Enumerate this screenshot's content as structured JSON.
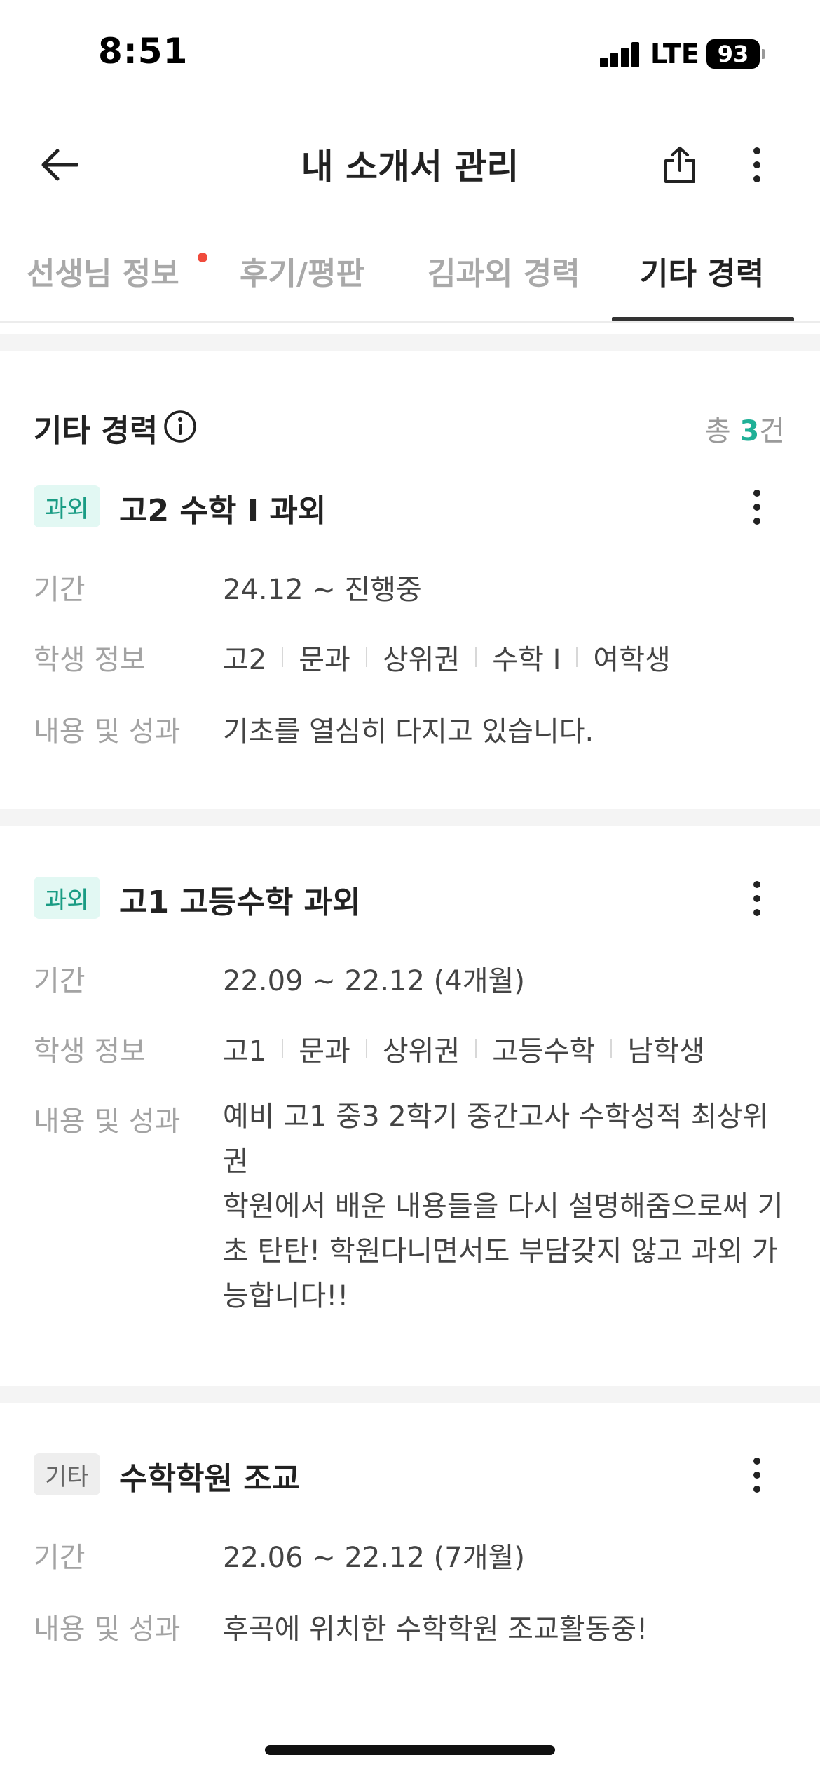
{
  "status_bar": {
    "time": "8:51",
    "network": "LTE",
    "battery": "93"
  },
  "header": {
    "title": "내 소개서 관리"
  },
  "tabs": [
    {
      "label": "선생님 정보",
      "has_dot": true
    },
    {
      "label": "후기/평판"
    },
    {
      "label": "김과외 경력"
    },
    {
      "label": "기타 경력",
      "active": true
    }
  ],
  "section": {
    "title": "기타 경력",
    "count_prefix": "총 ",
    "count": "3",
    "count_suffix": "건"
  },
  "labels": {
    "period": "기간",
    "student_info": "학생 정보",
    "content": "내용 및 성과"
  },
  "cards": [
    {
      "badge": "과외",
      "title": "고2 수학 I 과외",
      "period": "24.12 ~ 진행중",
      "student_tags": [
        "고2",
        "문과",
        "상위권",
        "수학 I",
        "여학생"
      ],
      "content": "기초를 열심히 다지고 있습니다."
    },
    {
      "badge": "과외",
      "title": "고1 고등수학 과외",
      "period": "22.09 ~ 22.12 (4개월)",
      "student_tags": [
        "고1",
        "문과",
        "상위권",
        "고등수학",
        "남학생"
      ],
      "content": "예비 고1 중3 2학기 중간고사 수학성적 최상위권\n학원에서 배운 내용들을 다시 설명해줌으로써 기초 탄탄! 학원다니면서도 부담갖지 않고 과외 가능합니다!!"
    },
    {
      "badge": "기타",
      "title": "수학학원 조교",
      "period": "22.06 ~ 22.12 (7개월)",
      "content": "후곡에 위치한 수학학원 조교활동중!"
    }
  ],
  "colors": {
    "accent": "#1fb097",
    "badge_bg": "#e2f8f3",
    "notification_dot": "#f04b3c"
  }
}
